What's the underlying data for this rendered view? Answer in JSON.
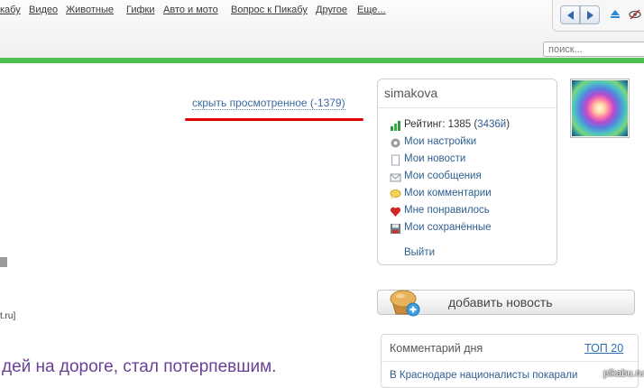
{
  "topnav": {
    "items": [
      "кабу",
      "Видео",
      "Животные",
      "Гифки",
      "Авто и мото",
      "Вопрос к Пикабу",
      "Другое",
      "Еще..."
    ]
  },
  "search": {
    "placeholder": "поиск..."
  },
  "main": {
    "hide_viewed": "скрыть просмотренное (-1379)",
    "fragment_tru": "t.ru]",
    "headline_fragment": "дей на дороге, стал потерпевшим."
  },
  "userbox": {
    "username": "simakova",
    "rating_label": "Рейтинг: 1385 (",
    "rating_extra": "3436й",
    "rating_close": ")",
    "menu": [
      {
        "label": "Мои настройки",
        "icon": "gear-icon"
      },
      {
        "label": "Мои новости",
        "icon": "page-icon"
      },
      {
        "label": "Мои сообщения",
        "icon": "envelope-icon"
      },
      {
        "label": "Мои комментарии",
        "icon": "speech-bubble-icon"
      },
      {
        "label": "Мне понравилось",
        "icon": "heart-icon"
      },
      {
        "label": "Мои сохранённые",
        "icon": "floppy-icon"
      }
    ],
    "logout": "Выйти"
  },
  "sidebar": {
    "add_news": "добавить новость",
    "comment_of_day": "Комментарий дня",
    "top20": "ТОП 20",
    "comment_text": "В Краснодаре националисты покарали"
  },
  "watermark": "pikabu.ru",
  "colors": {
    "accent_green": "#4fc04f",
    "link_blue": "#2f5f91",
    "underline_red": "#e10000",
    "headline_purple": "#6a3f98"
  }
}
